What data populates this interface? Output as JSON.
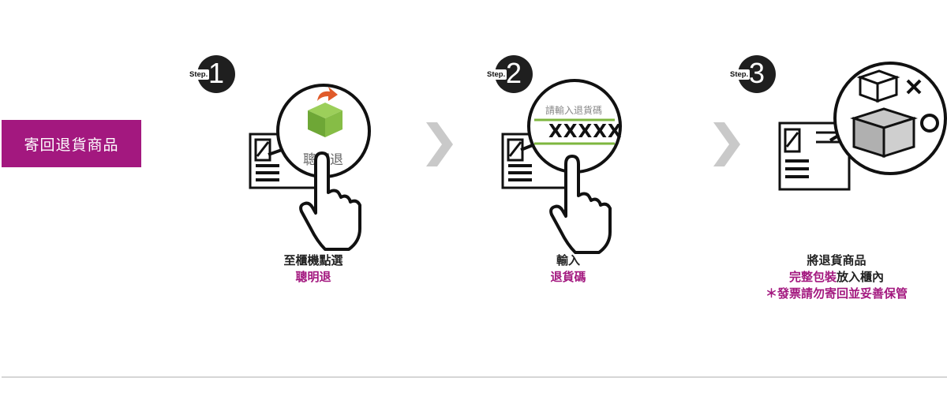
{
  "section_label": "寄回退貨商品",
  "steps": [
    {
      "badge_word": "Step.",
      "badge_num": "1",
      "zoom_text": "聰明退",
      "caption_line1": "至櫃機點選",
      "caption_line2": "聰明退"
    },
    {
      "badge_word": "Step.",
      "badge_num": "2",
      "zoom_label": "請輸入退貨碼",
      "zoom_code": "XXXXX",
      "caption_line1": "輸入",
      "caption_line2": "退貨碼"
    },
    {
      "badge_word": "Step.",
      "badge_num": "3",
      "caption_line1_hl": "完整包裝",
      "caption_line0": "將退貨商品",
      "caption_line1_rest": "放入櫃內",
      "caption_line2": "＊發票請勿寄回並妥善保管"
    }
  ],
  "icons": {
    "arrow": "chevron-right-icon",
    "kiosk": "kiosk-icon",
    "hand": "pointing-hand-icon",
    "box": "box-icon",
    "check": "circle-icon",
    "cross": "x-icon"
  },
  "colors": {
    "accent": "#a3187f",
    "green": "#7db63e",
    "dark": "#1f1f1f",
    "arrow": "#c9c9c9"
  }
}
